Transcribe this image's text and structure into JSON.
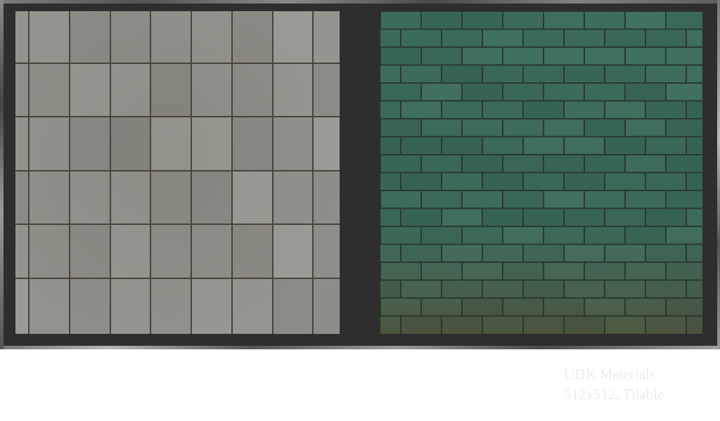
{
  "caption": {
    "line1": "UDK Materials",
    "line2": "512x512, Tilable"
  },
  "swatches": [
    {
      "material": "concrete-tiles",
      "base_color": "#8e8f88",
      "grout_color": "#4a4338"
    },
    {
      "material": "green-brick",
      "base_color": "#3f6b5c",
      "grout_color": "#2a3a30",
      "stain_color": "#5b4a32"
    }
  ],
  "colors": {
    "frame": "#2e2e2e",
    "caption_text": "#ececf0",
    "background": "#ffffff"
  }
}
